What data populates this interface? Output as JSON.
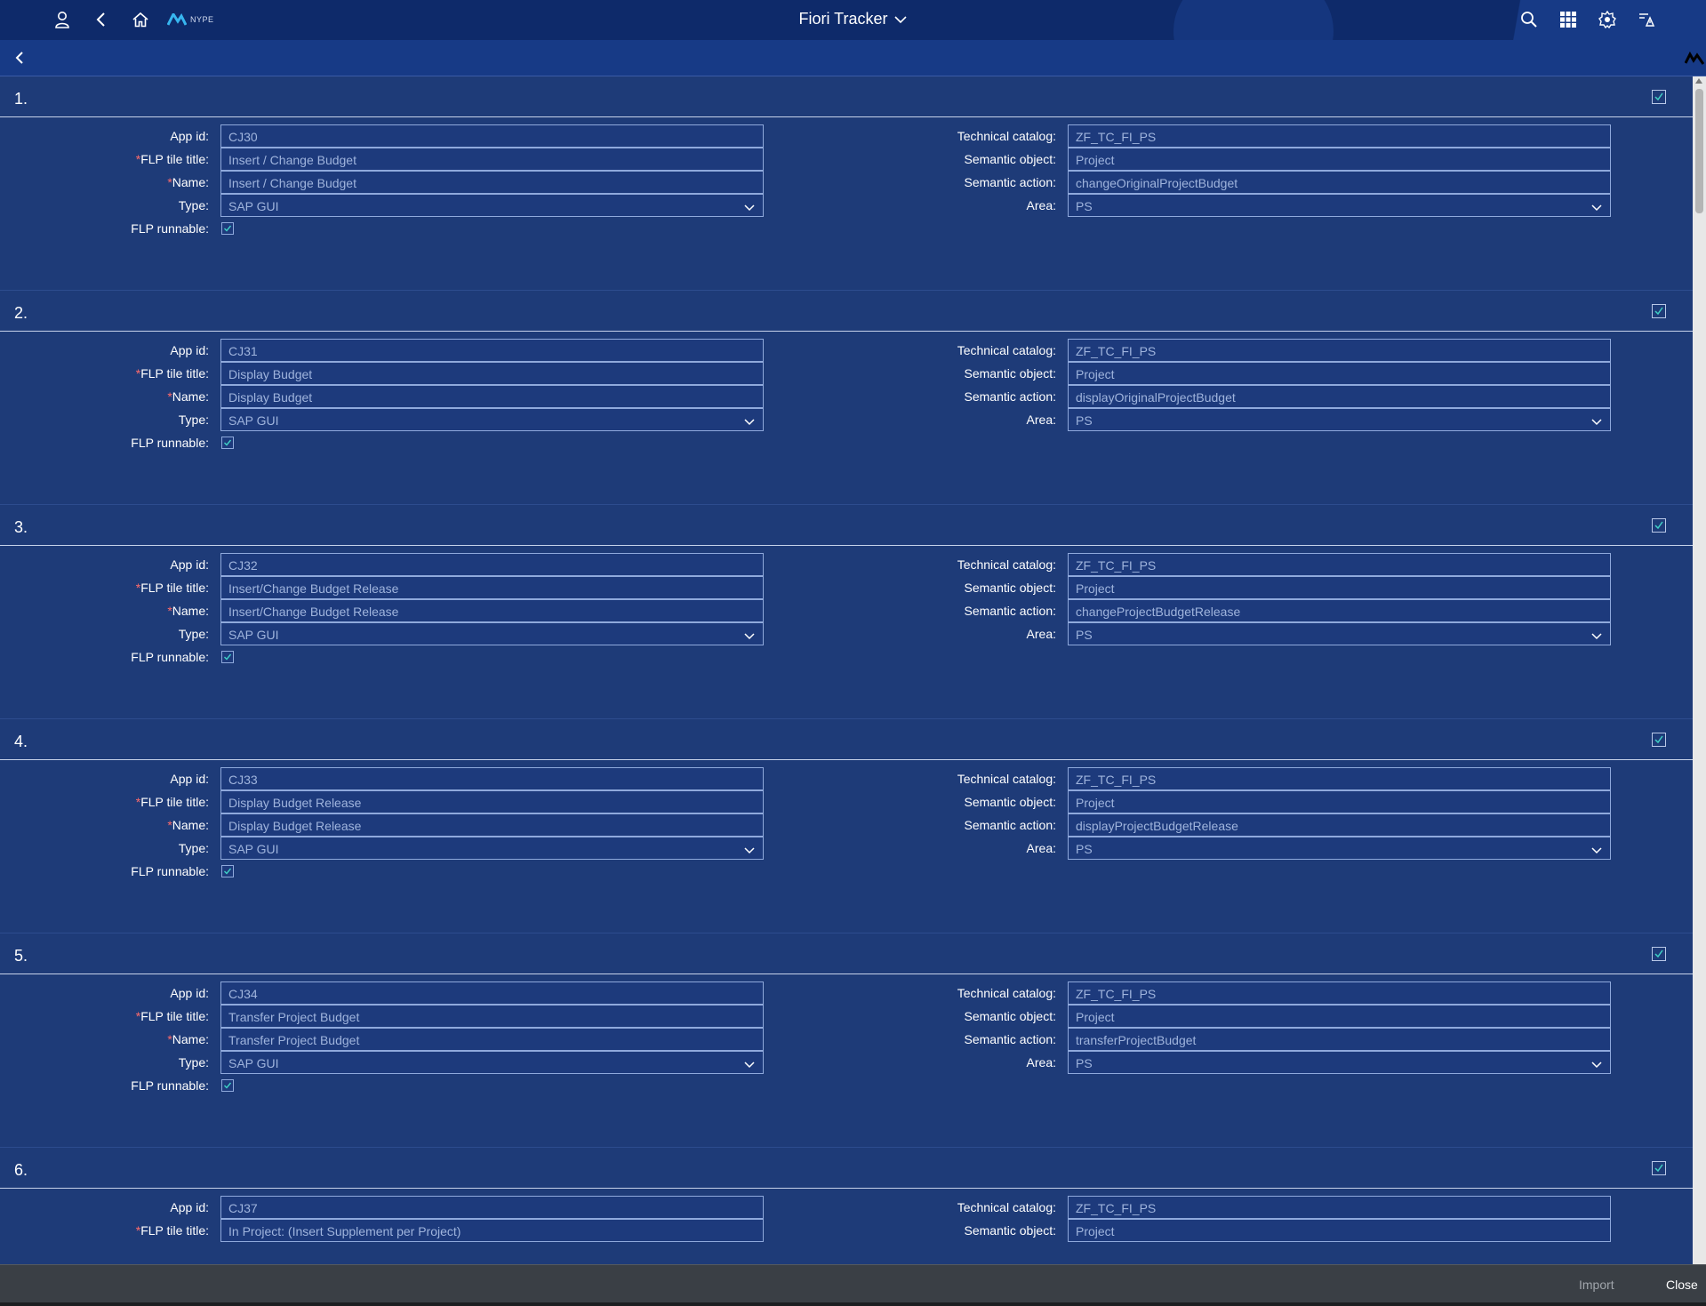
{
  "shell": {
    "title": "Fiori Tracker",
    "logo_text": "NYPE",
    "icons": [
      "user-icon",
      "back-icon",
      "home-icon",
      "search-icon",
      "apps-grid-icon",
      "notifications-icon",
      "help-icon"
    ]
  },
  "labels": {
    "app_id": "App id:",
    "flp_tile_title": "FLP tile title:",
    "name": "Name:",
    "type": "Type:",
    "flp_runnable": "FLP runnable:",
    "technical_catalog": "Technical catalog:",
    "semantic_object": "Semantic object:",
    "semantic_action": "Semantic action:",
    "area": "Area:",
    "required_mark": "*"
  },
  "sections": [
    {
      "number": "1.",
      "app_id": "CJ30",
      "flp_tile_title": "Insert / Change Budget",
      "name": "Insert / Change Budget",
      "type": "SAP GUI",
      "flp_runnable": true,
      "technical_catalog": "ZF_TC_FI_PS",
      "semantic_object": "Project",
      "semantic_action": "changeOriginalProjectBudget",
      "area": "PS",
      "selected": true
    },
    {
      "number": "2.",
      "app_id": "CJ31",
      "flp_tile_title": "Display Budget",
      "name": "Display Budget",
      "type": "SAP GUI",
      "flp_runnable": true,
      "technical_catalog": "ZF_TC_FI_PS",
      "semantic_object": "Project",
      "semantic_action": "displayOriginalProjectBudget",
      "area": "PS",
      "selected": true
    },
    {
      "number": "3.",
      "app_id": "CJ32",
      "flp_tile_title": "Insert/Change Budget Release",
      "name": "Insert/Change Budget Release",
      "type": "SAP GUI",
      "flp_runnable": true,
      "technical_catalog": "ZF_TC_FI_PS",
      "semantic_object": "Project",
      "semantic_action": "changeProjectBudgetRelease",
      "area": "PS",
      "selected": true
    },
    {
      "number": "4.",
      "app_id": "CJ33",
      "flp_tile_title": "Display Budget Release",
      "name": "Display Budget Release",
      "type": "SAP GUI",
      "flp_runnable": true,
      "technical_catalog": "ZF_TC_FI_PS",
      "semantic_object": "Project",
      "semantic_action": "displayProjectBudgetRelease",
      "area": "PS",
      "selected": true
    },
    {
      "number": "5.",
      "app_id": "CJ34",
      "flp_tile_title": "Transfer Project Budget",
      "name": "Transfer Project Budget",
      "type": "SAP GUI",
      "flp_runnable": true,
      "technical_catalog": "ZF_TC_FI_PS",
      "semantic_object": "Project",
      "semantic_action": "transferProjectBudget",
      "area": "PS",
      "selected": true
    },
    {
      "number": "6.",
      "app_id": "CJ37",
      "flp_tile_title": "In Project: (Insert Supplement per Project)",
      "technical_catalog": "ZF_TC_FI_PS",
      "semantic_object": "Project",
      "selected": true
    }
  ],
  "footer": {
    "import_label": "Import",
    "close_label": "Close"
  },
  "colors": {
    "shell": "#0e2a6a",
    "page": "#1e3b78",
    "field_border": "#8fa9dc",
    "field_text": "#9fb4dd",
    "required": "#ff6b6b",
    "footer": "#3a3f45"
  }
}
